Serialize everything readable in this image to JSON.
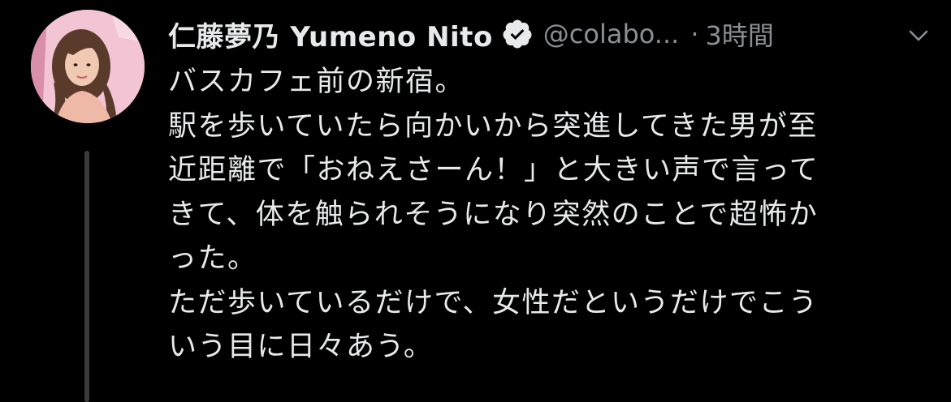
{
  "tweet": {
    "author": {
      "display_name": "仁藤夢乃 Yumeno Nito",
      "handle": "@colabo...",
      "verified": true,
      "avatar_icon": "profile-photo"
    },
    "separator": "·",
    "timestamp": "3時間",
    "menu_icon": "chevron-down-icon",
    "text_lines": [
      "バスカフェ前の新宿。",
      "駅を歩いていたら向かいから突進してきた男が至",
      "近距離で「おねえさーん！」と大きい声で言って",
      "きて、体を触られそうになり突然のことで超怖か",
      "った。",
      "ただ歩いているだけで、女性だというだけでこう",
      "いう目に日々あう。"
    ]
  },
  "colors": {
    "background": "#000000",
    "text_primary": "#e7e9ea",
    "text_secondary": "#8b8f94",
    "thread_line": "#3a3b3d"
  }
}
